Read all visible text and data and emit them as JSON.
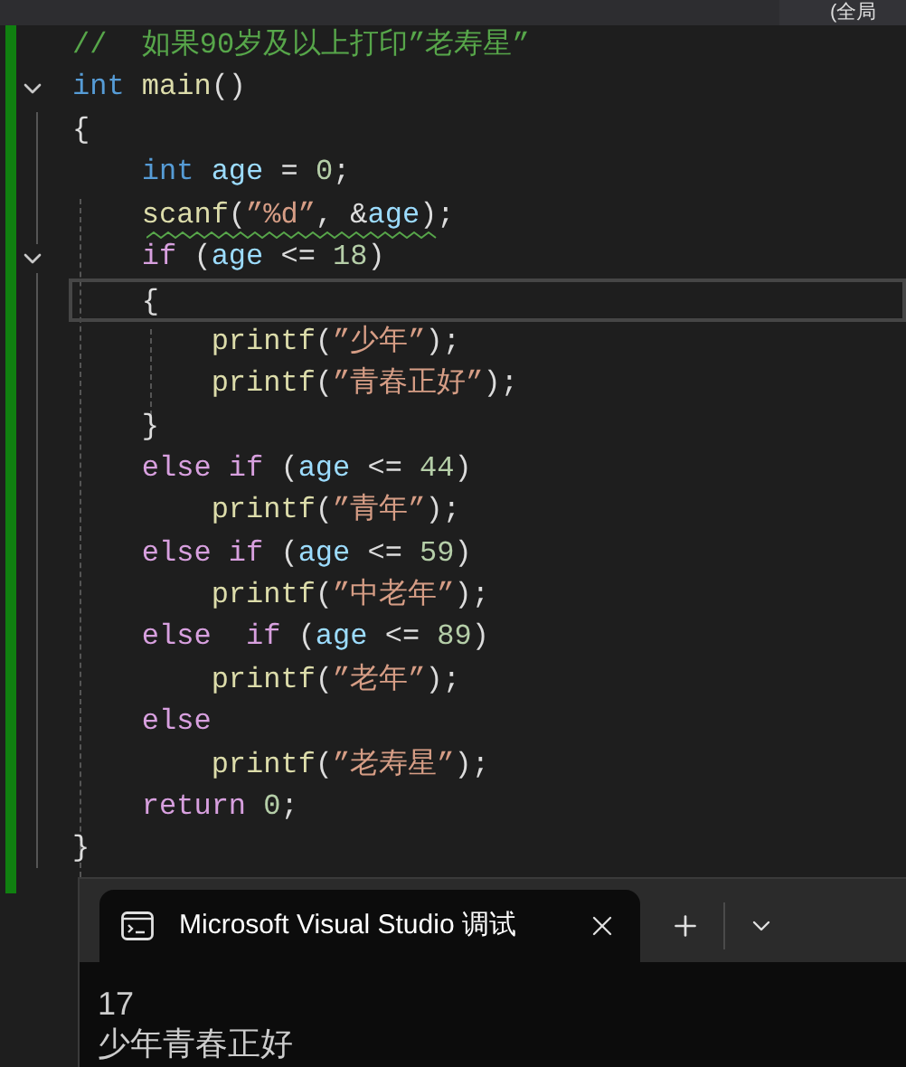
{
  "top_bar": {
    "scope_dropdown": "(全局"
  },
  "lines": [
    {
      "tokens": [
        {
          "kind": "comment",
          "text": "//  如果90岁及以上打印”老寿星”"
        }
      ]
    },
    {
      "expanded": true,
      "tokens": [
        {
          "kind": "keyword",
          "text": "int"
        },
        {
          "kind": "function",
          "text": " main"
        },
        {
          "kind": "plain",
          "text": "()"
        }
      ]
    },
    {
      "tokens": [
        {
          "kind": "plain",
          "text": "{"
        }
      ]
    },
    {
      "tokens": [
        {
          "kind": "keyword",
          "text": "    int"
        },
        {
          "kind": "variable",
          "text": " age"
        },
        {
          "kind": "plain",
          "text": " = "
        },
        {
          "kind": "number",
          "text": "0"
        },
        {
          "kind": "plain",
          "text": ";"
        }
      ]
    },
    {
      "squiggle": true,
      "tokens": [
        {
          "kind": "function",
          "text": "    scanf"
        },
        {
          "kind": "plain",
          "text": "("
        },
        {
          "kind": "string",
          "text": "”%d”"
        },
        {
          "kind": "plain",
          "text": ", &"
        },
        {
          "kind": "variable",
          "text": "age"
        },
        {
          "kind": "plain",
          "text": ");"
        }
      ]
    },
    {
      "expanded": true,
      "tokens": [
        {
          "kind": "control",
          "text": "    if"
        },
        {
          "kind": "plain",
          "text": " ("
        },
        {
          "kind": "variable",
          "text": "age"
        },
        {
          "kind": "plain",
          "text": " <= "
        },
        {
          "kind": "number",
          "text": "18"
        },
        {
          "kind": "plain",
          "text": ")"
        }
      ]
    },
    {
      "current": true,
      "tokens": [
        {
          "kind": "plain",
          "text": "    {"
        }
      ]
    },
    {
      "tokens": [
        {
          "kind": "function",
          "text": "        printf"
        },
        {
          "kind": "plain",
          "text": "("
        },
        {
          "kind": "string",
          "text": "”少年”"
        },
        {
          "kind": "plain",
          "text": ");"
        }
      ]
    },
    {
      "tokens": [
        {
          "kind": "function",
          "text": "        printf"
        },
        {
          "kind": "plain",
          "text": "("
        },
        {
          "kind": "string",
          "text": "”青春正好”"
        },
        {
          "kind": "plain",
          "text": ");"
        }
      ]
    },
    {
      "tokens": [
        {
          "kind": "plain",
          "text": "    }"
        }
      ]
    },
    {
      "tokens": [
        {
          "kind": "control",
          "text": "    else if"
        },
        {
          "kind": "plain",
          "text": " ("
        },
        {
          "kind": "variable",
          "text": "age"
        },
        {
          "kind": "plain",
          "text": " <= "
        },
        {
          "kind": "number",
          "text": "44"
        },
        {
          "kind": "plain",
          "text": ")"
        }
      ]
    },
    {
      "tokens": [
        {
          "kind": "function",
          "text": "        printf"
        },
        {
          "kind": "plain",
          "text": "("
        },
        {
          "kind": "string",
          "text": "”青年”"
        },
        {
          "kind": "plain",
          "text": ");"
        }
      ]
    },
    {
      "tokens": [
        {
          "kind": "control",
          "text": "    else if"
        },
        {
          "kind": "plain",
          "text": " ("
        },
        {
          "kind": "variable",
          "text": "age"
        },
        {
          "kind": "plain",
          "text": " <= "
        },
        {
          "kind": "number",
          "text": "59"
        },
        {
          "kind": "plain",
          "text": ")"
        }
      ]
    },
    {
      "tokens": [
        {
          "kind": "function",
          "text": "        printf"
        },
        {
          "kind": "plain",
          "text": "("
        },
        {
          "kind": "string",
          "text": "”中老年”"
        },
        {
          "kind": "plain",
          "text": ");"
        }
      ]
    },
    {
      "tokens": [
        {
          "kind": "control",
          "text": "    else  if"
        },
        {
          "kind": "plain",
          "text": " ("
        },
        {
          "kind": "variable",
          "text": "age"
        },
        {
          "kind": "plain",
          "text": " <= "
        },
        {
          "kind": "number",
          "text": "89"
        },
        {
          "kind": "plain",
          "text": ")"
        }
      ]
    },
    {
      "tokens": [
        {
          "kind": "function",
          "text": "        printf"
        },
        {
          "kind": "plain",
          "text": "("
        },
        {
          "kind": "string",
          "text": "”老年”"
        },
        {
          "kind": "plain",
          "text": ");"
        }
      ]
    },
    {
      "tokens": [
        {
          "kind": "control",
          "text": "    else"
        }
      ]
    },
    {
      "tokens": [
        {
          "kind": "function",
          "text": "        printf"
        },
        {
          "kind": "plain",
          "text": "("
        },
        {
          "kind": "string",
          "text": "”老寿星”"
        },
        {
          "kind": "plain",
          "text": ");"
        }
      ]
    },
    {
      "tokens": [
        {
          "kind": "control",
          "text": "    return"
        },
        {
          "kind": "number",
          "text": " 0"
        },
        {
          "kind": "plain",
          "text": ";"
        }
      ]
    },
    {
      "tokens": [
        {
          "kind": "plain",
          "text": "}"
        }
      ]
    }
  ],
  "terminal": {
    "tab": {
      "title": "Microsoft Visual Studio 调试",
      "selected": true
    },
    "output": [
      "17",
      "少年青春正好"
    ]
  }
}
